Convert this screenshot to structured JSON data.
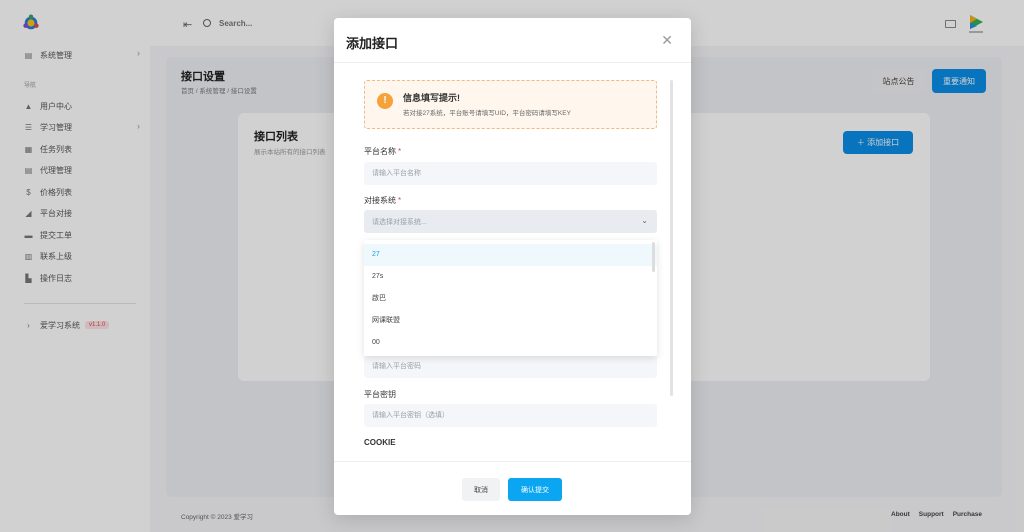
{
  "sidebar": {
    "top_item": "系统管理",
    "group_label": "导航",
    "items": [
      {
        "label": "用户中心",
        "icon": "▲",
        "has_chevron": false
      },
      {
        "label": "学习管理",
        "icon": "☰",
        "has_chevron": true
      },
      {
        "label": "任务列表",
        "icon": "▦",
        "has_chevron": false
      },
      {
        "label": "代理管理",
        "icon": "▤",
        "has_chevron": false
      },
      {
        "label": "价格列表",
        "icon": "$",
        "has_chevron": false
      },
      {
        "label": "平台对接",
        "icon": "◢",
        "has_chevron": false
      },
      {
        "label": "提交工单",
        "icon": "▬",
        "has_chevron": false
      },
      {
        "label": "联系上级",
        "icon": "▥",
        "has_chevron": false
      },
      {
        "label": "操作日志",
        "icon": "▙",
        "has_chevron": false
      }
    ],
    "app_name": "爱学习系统",
    "version": "v1.1.0"
  },
  "topbar": {
    "search_label": "Search..."
  },
  "page": {
    "title": "接口设置",
    "breadcrumb": "首页 / 系统管理 / 接口设置",
    "notice_button": "站点公告",
    "important_button": "重要通知",
    "list_title": "接口列表",
    "list_subtitle": "展示本站所有的接口列表",
    "add_button": "＋  添加接口"
  },
  "footer": {
    "copyright": "Copyright © 2023 爱学习",
    "links": [
      "About",
      "Support",
      "Purchase"
    ]
  },
  "modal": {
    "title": "添加接口",
    "alert_title": "信息填写提示!",
    "alert_text": "若对接27系统，平台账号请填写UID，平台密码请填写KEY",
    "platform_name_label": "平台名称",
    "platform_name_placeholder": "请输入平台名称",
    "system_label": "对接系统",
    "system_placeholder": "请选择对接系统...",
    "system_options": [
      "27",
      "27s",
      "啟巴",
      "网课联盟",
      "00"
    ],
    "selected_option": "27",
    "password_placeholder": "请输入平台密码",
    "key_label": "平台密钥",
    "key_placeholder": "请输入平台密钥（选填）",
    "cookie_label": "COOKIE",
    "cancel_button": "取消",
    "submit_button": "确认提交"
  },
  "colors": {
    "primary": "#0aa6f2",
    "brand_blue": "#0b8ee8",
    "required": "#e0444f",
    "warning": "#f6a23a"
  }
}
